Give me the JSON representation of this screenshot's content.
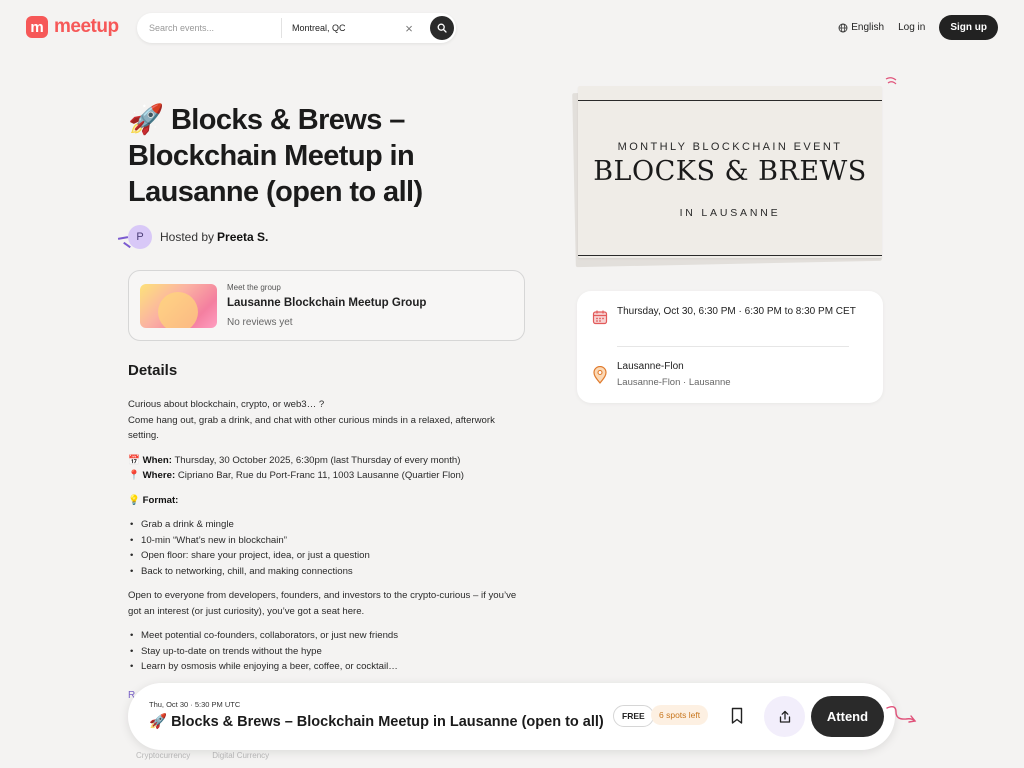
{
  "header": {
    "logo_mark": "m",
    "logo_text": "meetup",
    "search_placeholder": "Search events...",
    "location_value": "Montreal, QC",
    "clear_glyph": "×",
    "language": "English",
    "login": "Log in",
    "signup": "Sign up"
  },
  "event": {
    "title": "🚀 Blocks & Brews – Blockchain Meetup in Lausanne (open to all)",
    "host_initial": "P",
    "hosted_by": "Hosted by",
    "host_name": "Preeta S."
  },
  "group": {
    "meet_label": "Meet the group",
    "name": "Lausanne Blockchain Meetup Group",
    "reviews": "No reviews yet"
  },
  "details": {
    "heading": "Details",
    "intro_1": "Curious about blockchain, crypto, or web3… ?",
    "intro_2": "Come hang out, grab a drink, and chat with other curious minds in a relaxed, afterwork setting.",
    "when_icon": "📅",
    "when_label": "When:",
    "when_text": "Thursday, 30 October 2025, 6:30pm (last Thursday of every month)",
    "where_icon": "📍",
    "where_label": "Where:",
    "where_text": "Cipriano Bar, Rue du Port-Franc 11, 1003 Lausanne (Quartier Flon)",
    "format_icon": "💡",
    "format_label": "Format:",
    "format_items": [
      "Grab a drink & mingle",
      "10-min “What’s new in blockchain”",
      "Open floor: share your project, idea, or just a question",
      "Back to networking, chill, and making connections"
    ],
    "open_text": "Open to everyone from developers, founders, and investors to the crypto-curious – if you’ve got an interest (or just curiosity), you’ve got a seat here.",
    "benefits": [
      "Meet potential co-founders, collaborators, or just new friends",
      "Stay up-to-date on trends without the hype",
      "Learn by osmosis while enjoying a beer, coffee, or cocktail…"
    ],
    "read_more_fragment": "R",
    "tags": [
      "Cryptocurrency",
      "Digital Currency"
    ]
  },
  "poster": {
    "subtitle": "MONTHLY BLOCKCHAIN EVENT",
    "title": "BLOCKS & BREWS",
    "place": "IN LAUSANNE"
  },
  "info": {
    "datetime": "Thursday, Oct 30, 6:30 PM · 6:30 PM to 8:30 PM CET",
    "venue": "Lausanne-Flon",
    "address": "Lausanne-Flon · Lausanne"
  },
  "sticky": {
    "date": "Thu, Oct 30 · 5:30 PM UTC",
    "title": "🚀 Blocks & Brews – Blockchain Meetup in Lausanne (open to all)",
    "free": "FREE",
    "spots": "6 spots left",
    "attend": "Attend"
  },
  "colors": {
    "brand": "#f65858",
    "dark_button": "#2a2a2a",
    "spots_text": "#c8761e",
    "spots_bg": "#fdf0e2",
    "host_avatar": "#d8c8f7"
  }
}
